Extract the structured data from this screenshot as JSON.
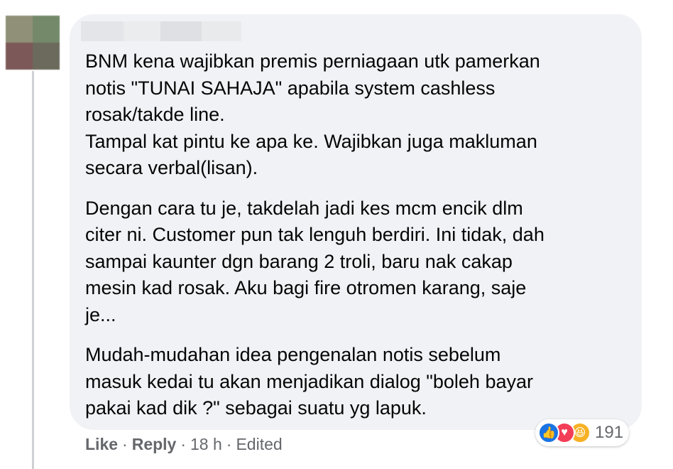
{
  "comment": {
    "paragraphs": [
      "BNM kena wajibkan premis perniagaan utk pamerkan\nnotis \"TUNAI SAHAJA\" apabila system cashless\nrosak/takde line.\nTampal kat pintu ke apa ke. Wajibkan juga makluman\nsecara verbal(lisan).",
      "Dengan cara tu je, takdelah jadi kes mcm encik dlm\nciter ni. Customer pun tak lenguh berdiri. Ini tidak, dah\nsampai kaunter dgn barang 2 troli, baru nak cakap\nmesin kad rosak. Aku bagi fire otromen karang, saje\nje...",
      "Mudah-mudahan idea pengenalan notis sebelum\nmasuk kedai tu akan menjadikan dialog \"boleh bayar\npakai kad dik ?\" sebagai suatu yg lapuk."
    ]
  },
  "reactions": {
    "icons": [
      "like-icon",
      "love-icon",
      "haha-icon"
    ],
    "like_glyph": "👍",
    "love_glyph": "♥",
    "haha_glyph": "😆",
    "count": "191"
  },
  "actions": {
    "like_label": "Like",
    "reply_label": "Reply",
    "time": "18 h",
    "edited": "Edited",
    "separator": "·"
  },
  "colors": {
    "bubble": "#f0f2f5",
    "text": "#050505",
    "meta": "#65676b",
    "like_blue": "#1b74e4",
    "love_red": "#f33e58",
    "haha_yellow": "#f7b125"
  }
}
